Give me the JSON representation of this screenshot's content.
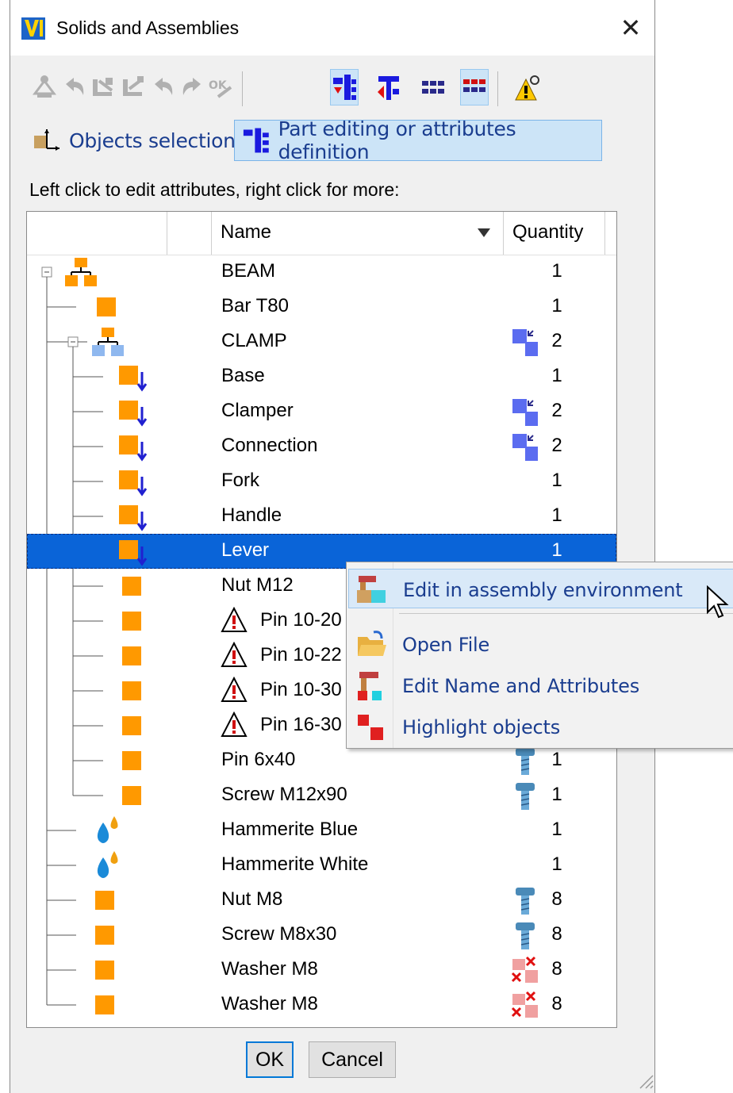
{
  "window": {
    "title": "Solids and Assemblies",
    "close_glyph": "✕"
  },
  "toolbar": {
    "icons": [
      "explode-icon",
      "undo-icon",
      "tree-collapse-icon",
      "tree-expand-icon",
      "undo-alt-icon",
      "redo-icon",
      "rename-icon",
      "tree-view-icon",
      "tree-sort-icon",
      "grid-view-icon",
      "grid-view-red-icon",
      "warning-settings-icon"
    ]
  },
  "modes": {
    "objects_selection": "Objects selection",
    "part_editing": "Part editing or attributes definition"
  },
  "instruction": "Left click to edit attributes, right click for more:",
  "grid": {
    "columns": {
      "name": "Name",
      "quantity": "Quantity"
    },
    "rows": [
      {
        "name": "BEAM",
        "qty": "1",
        "icon": "assembly",
        "qicon": ""
      },
      {
        "name": "Bar T80",
        "qty": "1",
        "icon": "part",
        "qicon": ""
      },
      {
        "name": "CLAMP",
        "qty": "2",
        "icon": "subassembly",
        "qicon": "instance"
      },
      {
        "name": "Base",
        "qty": "1",
        "icon": "part-down",
        "qicon": ""
      },
      {
        "name": "Clamper",
        "qty": "2",
        "icon": "part-down",
        "qicon": "instance"
      },
      {
        "name": "Connection",
        "qty": "2",
        "icon": "part-down",
        "qicon": "instance"
      },
      {
        "name": "Fork",
        "qty": "1",
        "icon": "part-down",
        "qicon": ""
      },
      {
        "name": "Handle",
        "qty": "1",
        "icon": "part-down",
        "qicon": ""
      },
      {
        "name": "Lever",
        "qty": "1",
        "icon": "part-down",
        "qicon": "",
        "selected": true
      },
      {
        "name": "Nut M12",
        "qty": "",
        "icon": "part",
        "qicon": ""
      },
      {
        "name": "Pin 10-20",
        "qty": "",
        "icon": "part",
        "qicon": "",
        "warn": true
      },
      {
        "name": "Pin 10-22",
        "qty": "",
        "icon": "part",
        "qicon": "",
        "warn": true
      },
      {
        "name": "Pin 10-30",
        "qty": "",
        "icon": "part",
        "qicon": "",
        "warn": true
      },
      {
        "name": "Pin 16-30",
        "qty": "",
        "icon": "part",
        "qicon": "",
        "warn": true
      },
      {
        "name": "Pin 6x40",
        "qty": "1",
        "icon": "part",
        "qicon": "screw"
      },
      {
        "name": "Screw M12x90",
        "qty": "1",
        "icon": "part",
        "qicon": "screw"
      },
      {
        "name": "Hammerite Blue",
        "qty": "1",
        "icon": "paint",
        "qicon": ""
      },
      {
        "name": "Hammerite White",
        "qty": "1",
        "icon": "paint",
        "qicon": ""
      },
      {
        "name": "Nut M8",
        "qty": "8",
        "icon": "part",
        "qicon": "screw"
      },
      {
        "name": "Screw M8x30",
        "qty": "8",
        "icon": "part",
        "qicon": "screw"
      },
      {
        "name": "Washer M8",
        "qty": "8",
        "icon": "part",
        "qicon": "pattern"
      },
      {
        "name": "Washer M8",
        "qty": "8",
        "icon": "part",
        "qicon": "pattern"
      }
    ]
  },
  "buttons": {
    "ok": "OK",
    "cancel": "Cancel"
  },
  "context_menu": {
    "items": [
      {
        "label": "Edit in assembly environment",
        "icon": "assembly-edit-icon"
      },
      {
        "label": "Open File",
        "icon": "folder-open-icon"
      },
      {
        "label": "Edit Name and Attributes",
        "icon": "edit-attributes-icon"
      },
      {
        "label": "Highlight objects",
        "icon": "highlight-icon"
      }
    ]
  },
  "colors": {
    "part_orange": "#ff9900",
    "selection_blue": "#0a64d8",
    "menu_text": "#1a3d8f",
    "instance_blue": "#5b6cf0"
  }
}
